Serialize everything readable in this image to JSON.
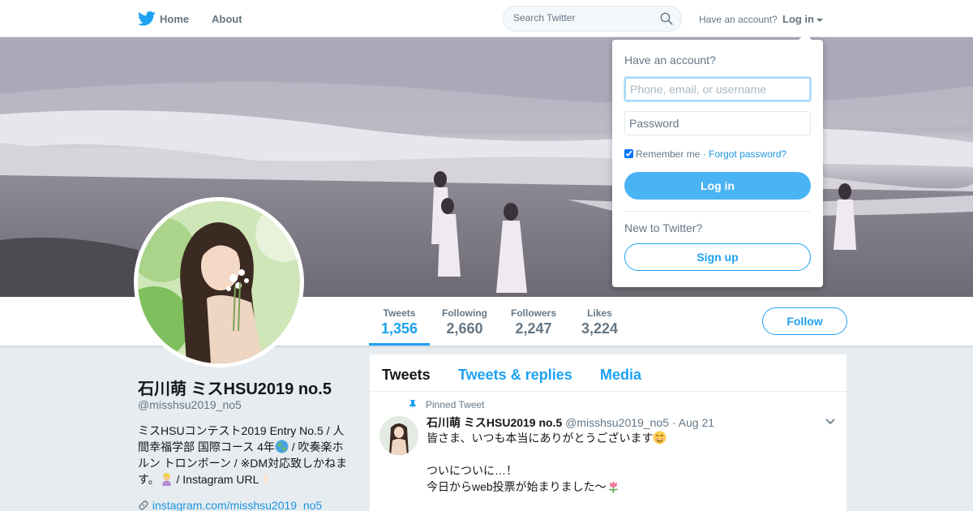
{
  "nav": {
    "home": "Home",
    "about": "About",
    "search_placeholder": "Search Twitter",
    "have_account": "Have an account?",
    "login": "Log in"
  },
  "login_dropdown": {
    "title": "Have an account?",
    "username_placeholder": "Phone, email, or username",
    "password_placeholder": "Password",
    "remember_me": "Remember me",
    "separator": "·",
    "forgot_password": "Forgot password?",
    "login_button": "Log in",
    "new_to_twitter": "New to Twitter?",
    "signup_button": "Sign up"
  },
  "stats": [
    {
      "label": "Tweets",
      "value": "1,356"
    },
    {
      "label": "Following",
      "value": "2,660"
    },
    {
      "label": "Followers",
      "value": "2,247"
    },
    {
      "label": "Likes",
      "value": "3,224"
    }
  ],
  "follow_button": "Follow",
  "profile": {
    "name": "石川萌 ミスHSU2019 no.5",
    "handle": "@misshsu2019_no5",
    "bio_1": "ミスHSUコンテスト2019 Entry No.5 / 人間幸福学部 国際コース 4年",
    "bio_2": " / 吹奏楽ホルン トロンボーン / ※DM対応致しかねます。",
    "bio_3": " / Instagram URL",
    "link": "instagram.com/misshsu2019_no5"
  },
  "timeline": {
    "tabs": [
      "Tweets",
      "Tweets & replies",
      "Media"
    ],
    "pinned_label": "Pinned Tweet",
    "tweet": {
      "name": "石川萌 ミスHSU2019 no.5",
      "handle": "@misshsu2019_no5",
      "date": "· Aug 21",
      "line1": "皆さま、いつも本当にありがとうございます",
      "line2": "ついについに…！",
      "line3": "今日からweb投票が始まりました〜"
    }
  },
  "colors": {
    "accent": "#1da1f2",
    "login_button": "#4ab3f4",
    "background": "#e6ecf0"
  },
  "icons": [
    "twitter-bird-icon",
    "search-icon",
    "caret-down-icon",
    "pin-icon",
    "link-icon",
    "chevron-down-icon"
  ]
}
